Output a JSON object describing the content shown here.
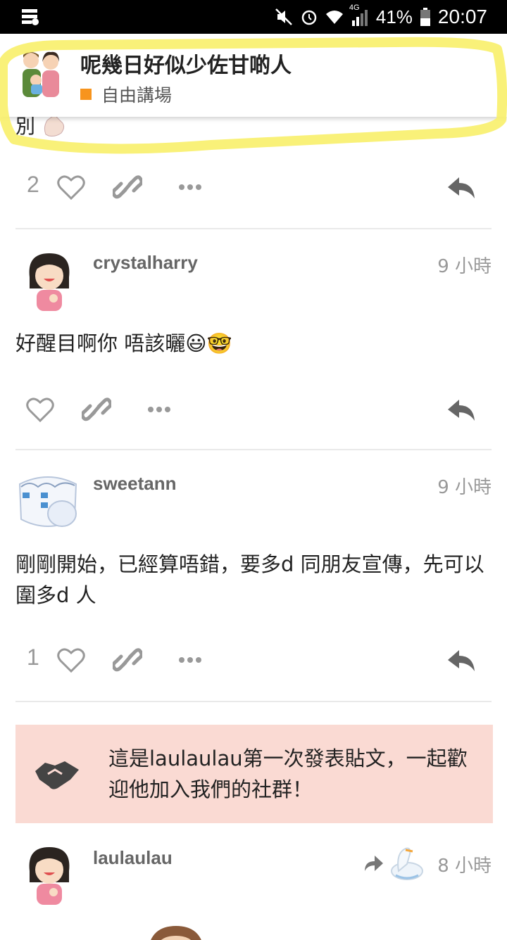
{
  "status_bar": {
    "signal_label": "4G",
    "battery": "41%",
    "time": "20:07"
  },
  "topic": {
    "title": "呢幾日好似少佐甘啲人",
    "category": "自由講場",
    "category_color": "#f7941d"
  },
  "partial_post": {
    "text_fragment": "別",
    "likes": "2"
  },
  "posts": [
    {
      "username": "crystalharry",
      "time": "9 小時",
      "body": "好醒目啊你 唔該曬😃🤓",
      "likes": ""
    },
    {
      "username": "sweetann",
      "time": "9 小時",
      "body": "剛剛開始，已經算唔錯，要多d 同朋友宣傳，先可以圍多d 人",
      "likes": "1"
    },
    {
      "username": "laulaulau",
      "time": "8 小時"
    }
  ],
  "notice": {
    "text": "這是laulaulau第一次發表貼文，一起歡迎他加入我們的社群！"
  },
  "icons": {
    "like": "heart-outline-icon",
    "link": "link-icon",
    "more": "ellipsis-icon",
    "reply": "reply-arrow-icon",
    "handshake": "handshake-icon"
  },
  "colors": {
    "notice_bg": "#fadad3",
    "highlight": "#f8ef6a",
    "icon_gray": "#999999"
  }
}
